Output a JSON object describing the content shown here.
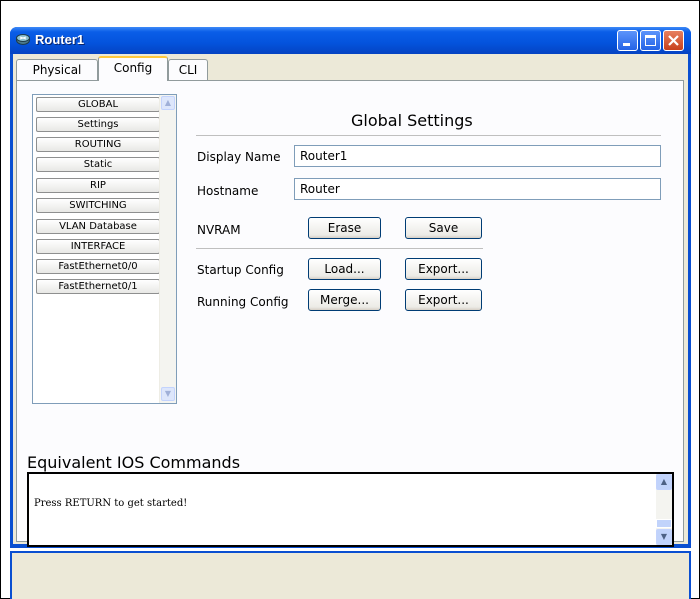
{
  "window": {
    "title": "Router1",
    "icon": "router-icon",
    "controls": {
      "minimize": "minimize-icon",
      "maximize": "maximize-icon",
      "close": "close-icon"
    }
  },
  "tabs": [
    {
      "label": "Physical",
      "active": false
    },
    {
      "label": "Config",
      "active": true
    },
    {
      "label": "CLI",
      "active": false
    }
  ],
  "sidebar": {
    "items": [
      {
        "label": "GLOBAL",
        "type": "header"
      },
      {
        "label": "Settings",
        "type": "item"
      },
      {
        "label": "ROUTING",
        "type": "header"
      },
      {
        "label": "Static",
        "type": "item"
      },
      {
        "label": "RIP",
        "type": "item"
      },
      {
        "label": "SWITCHING",
        "type": "header"
      },
      {
        "label": "VLAN Database",
        "type": "item"
      },
      {
        "label": "INTERFACE",
        "type": "header"
      },
      {
        "label": "FastEthernet0/0",
        "type": "item"
      },
      {
        "label": "FastEthernet0/1",
        "type": "item"
      }
    ]
  },
  "global_settings": {
    "title": "Global Settings",
    "display_name_label": "Display Name",
    "display_name_value": "Router1",
    "hostname_label": "Hostname",
    "hostname_value": "Router",
    "nvram_label": "NVRAM",
    "erase_label": "Erase",
    "save_label": "Save",
    "startup_config_label": "Startup Config",
    "load_label": "Load...",
    "startup_export_label": "Export...",
    "running_config_label": "Running Config",
    "merge_label": "Merge...",
    "running_export_label": "Export..."
  },
  "ios": {
    "title": "Equivalent IOS Commands",
    "text": "Press RETURN to get started!"
  },
  "colors": {
    "titlebar": "#0a5ee8",
    "active_tab_accent": "#ffc83c",
    "window_bg": "#ece9d8"
  }
}
